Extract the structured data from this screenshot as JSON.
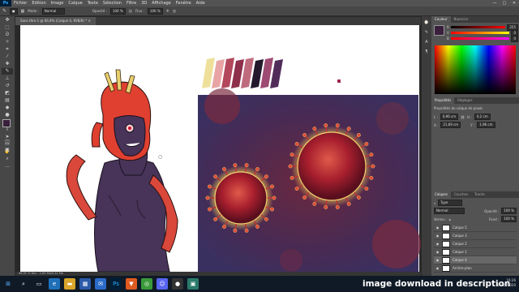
{
  "menubar": {
    "app_logo": "Ps",
    "items": [
      "Fichier",
      "Edition",
      "Image",
      "Calque",
      "Texte",
      "Sélection",
      "Filtre",
      "3D",
      "Affichage",
      "Fenêtre",
      "Aide"
    ],
    "window_controls": [
      "—",
      "□",
      "✕"
    ]
  },
  "options": {
    "mode_label": "Mode :",
    "mode_value": "Normal",
    "opacity_label": "Opacité :",
    "opacity_value": "100 %",
    "flow_label": "Flux :",
    "flow_value": "100 %"
  },
  "document": {
    "tab_title": "Sans titre-1 @ 66,9% (Calque 4, RVB/8) *",
    "status": "66,91 %    Doc : 2,64 Mo/5,41 Mo"
  },
  "palette_colors": [
    "#eee09a",
    "#e8a4a4",
    "#b3485c",
    "#8e2f4c",
    "#c06a7e",
    "#24182c",
    "#9e4a72",
    "#512c5a"
  ],
  "color_panel": {
    "tabs": [
      "Couleur",
      "Nuancier"
    ],
    "channels": [
      {
        "label": "R",
        "value": "255"
      },
      {
        "label": "V",
        "value": "0"
      },
      {
        "label": "B",
        "value": "0"
      }
    ]
  },
  "properties_panel": {
    "tabs": [
      "Propriétés",
      "Réglages"
    ],
    "title": "Propriétés du calque de pixels",
    "fields": [
      {
        "label": "L :",
        "value": "0,96 cm"
      },
      {
        "label": "H :",
        "value": "0,2 cm"
      },
      {
        "label": "X :",
        "value": "21,69 cm"
      },
      {
        "label": "Y :",
        "value": "1,96 cm"
      }
    ]
  },
  "layers_panel": {
    "tabs": [
      "Calques",
      "Couches",
      "Tracés"
    ],
    "filter_label": "Type",
    "blend_mode": "Normal",
    "opacity_label": "Opacité :",
    "opacity_value": "100 %",
    "lock_label": "Verrou :",
    "fill_label": "Fond :",
    "fill_value": "100 %",
    "layers": [
      {
        "name": "Calque 5",
        "selected": false
      },
      {
        "name": "Calque 3",
        "selected": false
      },
      {
        "name": "Calque 2",
        "selected": false
      },
      {
        "name": "Calque 1",
        "selected": false
      },
      {
        "name": "Calque 4",
        "selected": true
      },
      {
        "name": "Arrière-plan",
        "selected": false
      }
    ]
  },
  "taskbar": {
    "caption": "image download in description",
    "time": "16:26",
    "date": "21/05/2020"
  }
}
